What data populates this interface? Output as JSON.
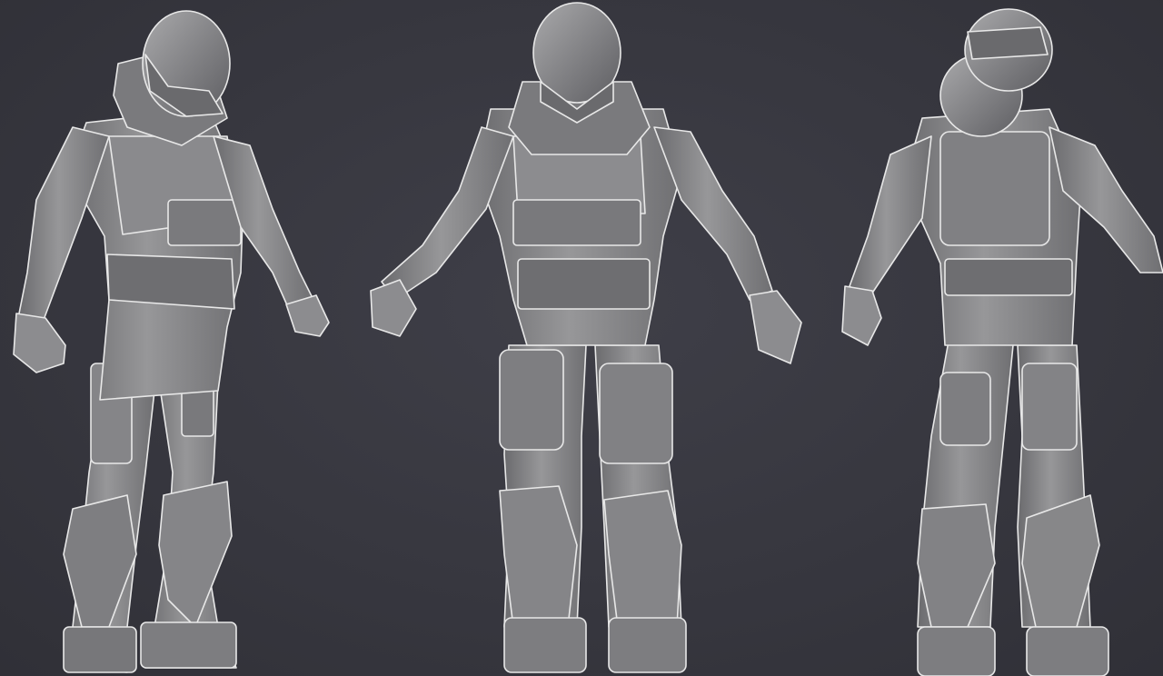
{
  "scene": {
    "background_color": "#3a3a42",
    "model_color": "#8c8c8c",
    "model_shadow_color": "#4f4f54",
    "model_highlight_color": "#b8b8b8",
    "rim_light_color": "#e6e6e6"
  },
  "figures": [
    {
      "id": "left",
      "view": "three-quarter-front"
    },
    {
      "id": "center",
      "view": "front"
    },
    {
      "id": "right",
      "view": "three-quarter-back"
    }
  ]
}
